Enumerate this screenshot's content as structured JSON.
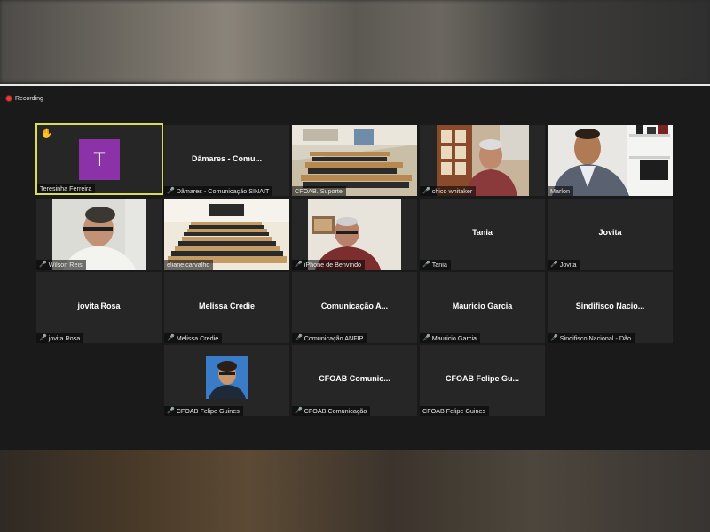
{
  "recording": {
    "label": "Recording"
  },
  "tiles": [
    {
      "label": "Teresinha Ferreira",
      "display": "T",
      "hand_raised": true,
      "active_speaker": true,
      "muted": false
    },
    {
      "label": "Dâmares - Comunicação SINAIT",
      "display": "Dâmares - Comu...",
      "muted": true
    },
    {
      "label": "CFOAB. Suporte",
      "muted": false,
      "video": "classroom"
    },
    {
      "label": "chico whitaker",
      "muted": true,
      "video": "person"
    },
    {
      "label": "Marlon",
      "muted": false,
      "video": "person"
    },
    {
      "label": "Wilson Reis",
      "muted": true,
      "video": "person"
    },
    {
      "label": "eliane.carvalho",
      "muted": false,
      "video": "classroom"
    },
    {
      "label": "iPhone de Benvindo",
      "muted": true,
      "video": "person"
    },
    {
      "label": "Tania",
      "display": "Tania",
      "muted": true
    },
    {
      "label": "Jovita",
      "display": "Jovita",
      "muted": true
    },
    {
      "label": "jovita Rosa",
      "display": "jovita Rosa",
      "muted": true
    },
    {
      "label": "Melissa Credie",
      "display": "Melissa Credie",
      "muted": true
    },
    {
      "label": "Comunicação ANFIP",
      "display": "Comunicação A...",
      "muted": true
    },
    {
      "label": "Mauricio Garcia",
      "display": "Mauricio Garcia",
      "muted": true
    },
    {
      "label": "Sindifisco Nacional - Dão",
      "display": "Sindifisco Nacio...",
      "muted": true
    },
    {
      "label": "CFOAB Felipe Guines",
      "muted": true,
      "video": "avatar-photo"
    },
    {
      "label": "CFOAB Comunicação",
      "display": "CFOAB Comunic...",
      "muted": true
    },
    {
      "label": "CFOAB Felipe Guines",
      "display": "CFOAB Felipe Gu...",
      "muted": false
    }
  ],
  "icons": {
    "mic_muted": "mic-off-icon",
    "raise_hand": "raised-hand-icon",
    "recording": "recording-dot-icon"
  },
  "colors": {
    "active_border": "#d7dc59",
    "avatar_bg": "#8b32a8",
    "muted_mic": "#e05050",
    "recording": "#e23b3b"
  }
}
